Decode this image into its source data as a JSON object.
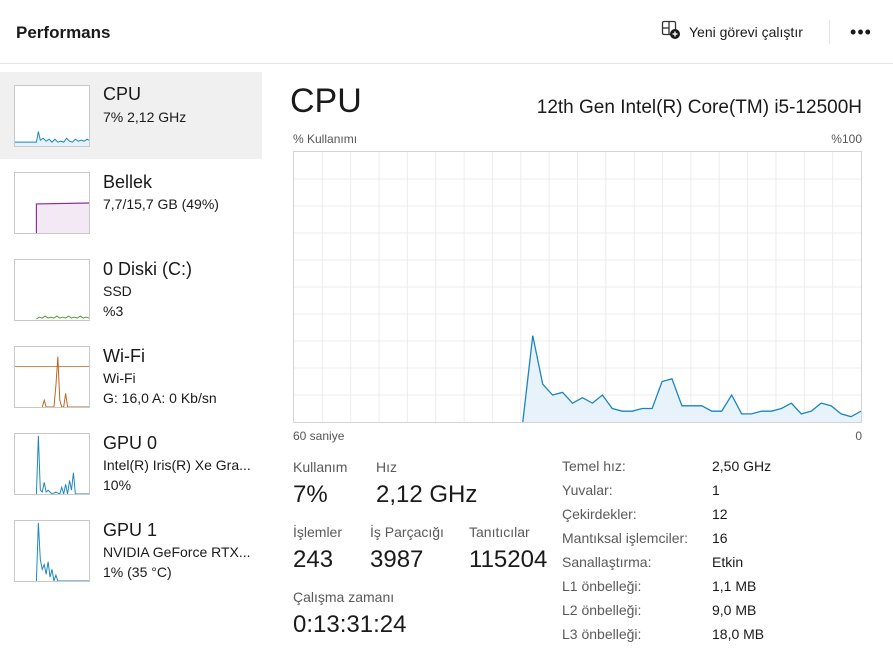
{
  "header": {
    "title": "Performans",
    "run_task_label": "Yeni görevi çalıştır",
    "more_glyph": "•••"
  },
  "sidebar": {
    "items": [
      {
        "name": "CPU",
        "line2": "7%  2,12 GHz",
        "line3": "",
        "graph_color": "#1a86c0",
        "active": true
      },
      {
        "name": "Bellek",
        "line2": "7,7/15,7 GB (49%)",
        "line3": "",
        "graph_color": "#8b2d9b",
        "active": false
      },
      {
        "name": "0 Diski (C:)",
        "line2": "SSD",
        "line3": "%3",
        "graph_color": "#4aa02c",
        "active": false
      },
      {
        "name": "Wi-Fi",
        "line2": "Wi-Fi",
        "line3": "G: 16,0  A: 0 Kb/sn",
        "graph_color": "#c0631b",
        "active": false
      },
      {
        "name": "GPU 0",
        "line2": "Intel(R) Iris(R) Xe Gra...",
        "line3": "10%",
        "graph_color": "#1a86c0",
        "active": false
      },
      {
        "name": "GPU 1",
        "line2": "NVIDIA GeForce RTX...",
        "line3": "1%  (35 °C)",
        "graph_color": "#1a86c0",
        "active": false
      }
    ]
  },
  "main": {
    "title": "CPU",
    "model": "12th Gen Intel(R) Core(TM) i5-12500H",
    "axis_top_left": "% Kullanımı",
    "axis_top_right": "%100",
    "axis_bottom_left": "60 saniye",
    "axis_bottom_right": "0",
    "accent_color": "#1a86c0",
    "stats": {
      "usage_label": "Kullanım",
      "usage_value": "7%",
      "speed_label": "Hız",
      "speed_value": "2,12 GHz",
      "processes_label": "İşlemler",
      "processes_value": "243",
      "threads_label": "İş Parçacığı",
      "threads_value": "3987",
      "handles_label": "Tanıtıcılar",
      "handles_value": "115204",
      "uptime_label": "Çalışma zamanı",
      "uptime_value": "0:13:31:24"
    },
    "properties": [
      {
        "key": "Temel hız:",
        "value": "2,50 GHz"
      },
      {
        "key": "Yuvalar:",
        "value": "1"
      },
      {
        "key": "Çekirdekler:",
        "value": "12"
      },
      {
        "key": "Mantıksal işlemciler:",
        "value": "16"
      },
      {
        "key": "Sanallaştırma:",
        "value": "Etkin"
      },
      {
        "key": "L1 önbelleği:",
        "value": "1,1 MB"
      },
      {
        "key": "L2 önbelleği:",
        "value": "9,0 MB"
      },
      {
        "key": "L3 önbelleği:",
        "value": "18,0 MB"
      }
    ],
    "usage_history": [
      0,
      0,
      0,
      0,
      0,
      0,
      0,
      0,
      0,
      0,
      0,
      0,
      0,
      0,
      0,
      0,
      0,
      0,
      0,
      0,
      0,
      0,
      0,
      0,
      32,
      14,
      10,
      11,
      7,
      9,
      7,
      10,
      5,
      4,
      4,
      5,
      5,
      15,
      16,
      6,
      6,
      6,
      4,
      4,
      10,
      3,
      3,
      4,
      4,
      5,
      7,
      3,
      4,
      7,
      6,
      3,
      2,
      4
    ]
  }
}
